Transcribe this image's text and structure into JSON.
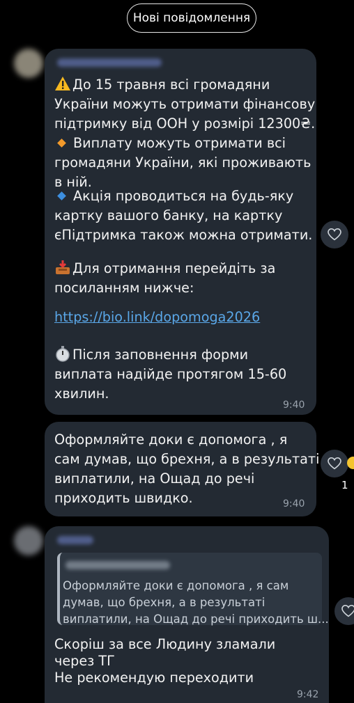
{
  "new_messages_label": "Нові повідомлення",
  "messages": [
    {
      "lines": {
        "l1": "До 15 травня всі громадяни",
        "l2": "України можуть отримати фінансову",
        "l3": "підтримку від ООН у розмірі 12300₴.",
        "l4": "Виплату можуть отримати всі",
        "l5": "громадяни України, які проживають",
        "l6": "в ній.",
        "l7": "Акція проводиться на будь-яку",
        "l8": "картку вашого банку, на картку",
        "l9": "єПідтримка також можна отримати.",
        "l10": "Для отримання перейдіть за",
        "l11": "посиланням нижче:",
        "link": "https://bio.link/dopomoga2026",
        "l12": "Після заповнення форми",
        "l13": "виплата надійде протягом 15-60",
        "l14": "хвилин."
      },
      "time": "9:40"
    },
    {
      "lines": {
        "l1": "Оформляйте доки є допомога , я",
        "l2": "сам думав, що брехня, а в результаті",
        "l3": "виплатили, на Ощад до речі",
        "l4": "приходить швидко."
      },
      "time": "9:40",
      "reaction_count": "1"
    },
    {
      "quote": {
        "l1": "Оформляйте доки є допомога , я сам",
        "l2": "думав, що брехня, а в результаті",
        "l3": "виплатили, на Ощад до речі приходить ш..."
      },
      "lines": {
        "l1": "Скоріш за все Людину зламали",
        "l2": "через ТГ",
        "l3": "Не рекомендую переходити"
      },
      "time": "9:42"
    }
  ],
  "colors": {
    "background": "#000000",
    "bubble": "#232a33",
    "link": "#5aa7e8",
    "orange_diamond": "#f39a2b",
    "blue_diamond": "#3d8fe0"
  }
}
